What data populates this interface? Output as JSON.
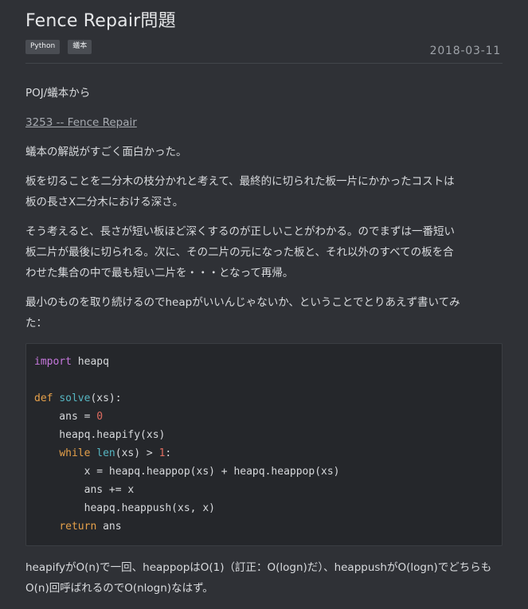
{
  "post": {
    "title": "Fence Repair問題",
    "tags": [
      "Python",
      "蟻本"
    ],
    "date": "2018-03-11"
  },
  "content": {
    "p1": "POJ/蟻本から",
    "link_text": "3253 -- Fence Repair",
    "p2": "蟻本の解説がすごく面白かった。",
    "p3_line1": "板を切ることを二分木の枝分かれと考えて、最終的に切られた板一片にかかったコストは",
    "p3_line2": "板の長さX二分木における深さ。",
    "p4_line1": "そう考えると、長さが短い板ほど深くするのが正しいことがわかる。のでまずは一番短い",
    "p4_line2": "板二片が最後に切られる。次に、その二片の元になった板と、それ以外のすべての板を合",
    "p4_line3": "わせた集合の中で最も短い二片を・・・となって再帰。",
    "p5_line1": "最小のものを取り続けるのでheapがいいんじゃないか、ということでとりあえず書いてみ",
    "p5_line2": "た：",
    "p6_line1": "heapifyがO(n)で一回、heappopはO(1)（訂正：O(logn)だ）、heappushがO(logn)でどちらも",
    "p6_line2": "O(n)回呼ばれるのでO(nlogn)なはず。"
  },
  "code": {
    "lines": [
      "import heapq",
      "",
      "def solve(xs):",
      "    ans = 0",
      "    heapq.heapify(xs)",
      "    while len(xs) > 1:",
      "        x = heapq.heappop(xs) + heapq.heappop(xs)",
      "        ans += x",
      "        heapq.heappush(xs, x)",
      "    return ans"
    ]
  },
  "colors": {
    "background": "#2f3136",
    "code_background": "#25272b",
    "keyword_purple": "#c678dd",
    "keyword_orange": "#e5a04a",
    "function_cyan": "#56b6c2",
    "number_red": "#e06c60"
  }
}
